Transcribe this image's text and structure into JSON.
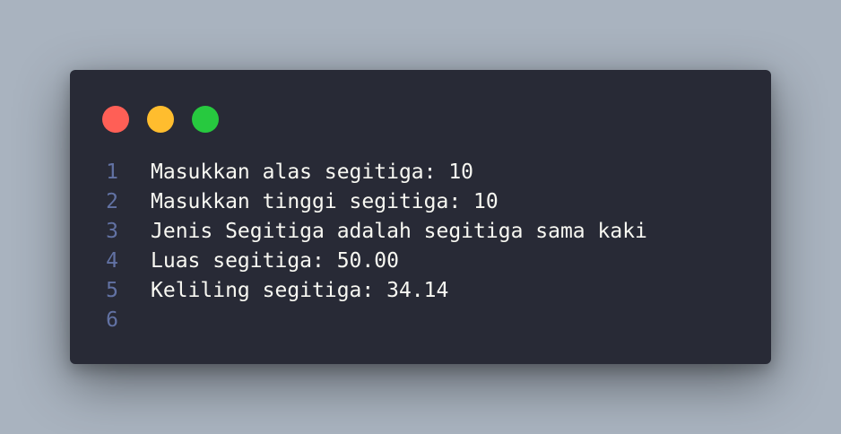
{
  "window": {
    "controls": [
      {
        "name": "close-button",
        "color": "#ff5f56"
      },
      {
        "name": "minimize-button",
        "color": "#ffbd2e"
      },
      {
        "name": "maximize-button",
        "color": "#27c93f"
      }
    ]
  },
  "code": {
    "lines": [
      {
        "number": "1",
        "text": "Masukkan alas segitiga: 10"
      },
      {
        "number": "2",
        "text": "Masukkan tinggi segitiga: 10"
      },
      {
        "number": "3",
        "text": "Jenis Segitiga adalah segitiga sama kaki"
      },
      {
        "number": "4",
        "text": "Luas segitiga: 50.00"
      },
      {
        "number": "5",
        "text": "Keliling segitiga: 34.14"
      },
      {
        "number": "6",
        "text": ""
      }
    ]
  },
  "colors": {
    "background": "#a9b3bf",
    "window_bg": "#282a36",
    "line_number": "#6272a4",
    "text": "#f8f8f2"
  }
}
